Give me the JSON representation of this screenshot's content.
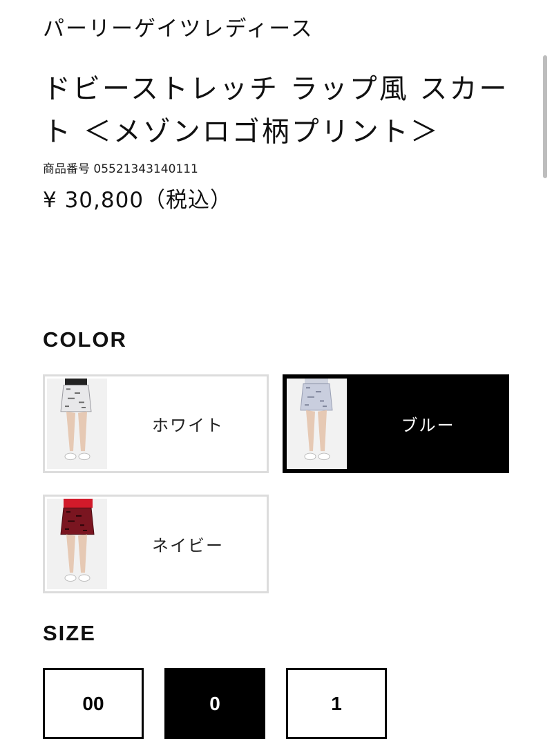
{
  "product": {
    "brand": "パーリーゲイツレディース",
    "title": "ドビーストレッチ ラップ風 スカート ＜メゾンロゴ柄プリント＞",
    "product_number": "商品番号 05521343140111",
    "price": "¥ 30,800（税込）"
  },
  "color_section": {
    "heading": "COLOR",
    "options": [
      {
        "label": "ホワイト",
        "selected": false,
        "thumb_icon": "skirt-photo-white"
      },
      {
        "label": "ブルー",
        "selected": true,
        "thumb_icon": "skirt-photo-blue"
      },
      {
        "label": "ネイビー",
        "selected": false,
        "thumb_icon": "skirt-photo-navy"
      }
    ]
  },
  "size_section": {
    "heading": "SIZE",
    "options": [
      {
        "label": "00",
        "selected": false
      },
      {
        "label": "0",
        "selected": true
      },
      {
        "label": "1",
        "selected": false
      }
    ]
  },
  "colors": {
    "selected_bg": "#000000",
    "unselected_border": "#dcdcdc",
    "text": "#111111",
    "skirt_white": "#e8e8ea",
    "skirt_blue": "#c9cede",
    "skirt_navy": "#7a1520"
  }
}
